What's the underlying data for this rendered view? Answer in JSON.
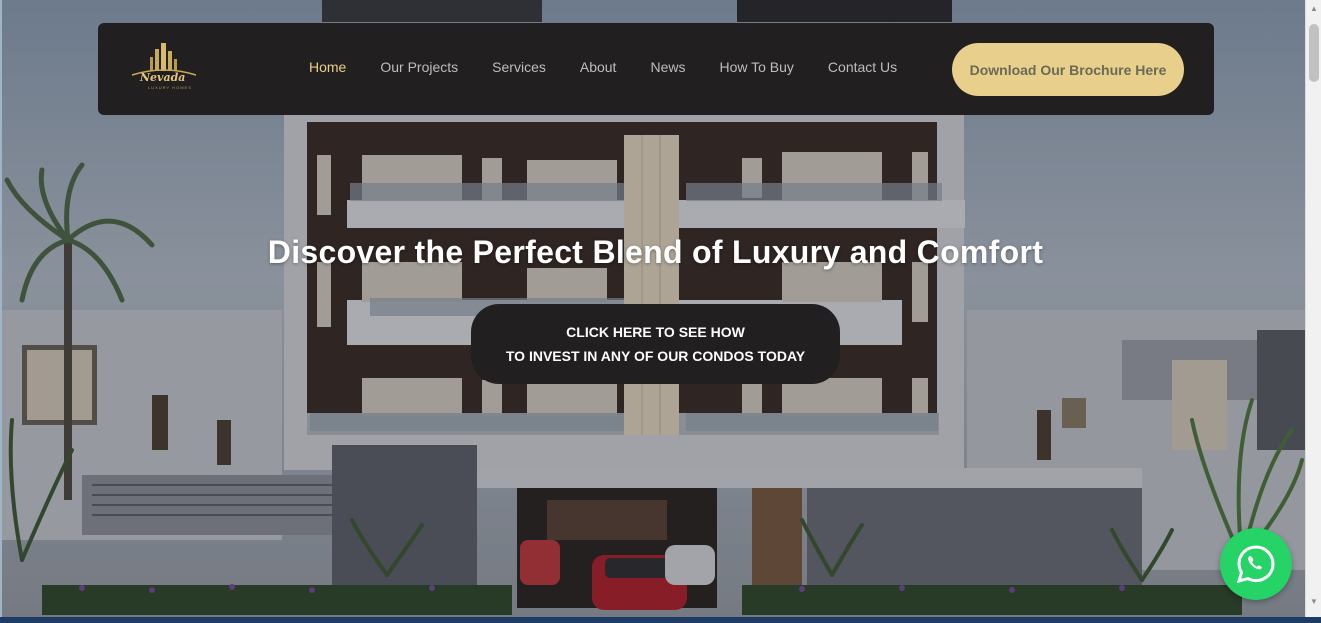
{
  "nav": {
    "logo_text": "Nevada",
    "logo_sub": "LUXURY HOMES",
    "links": [
      "Home",
      "Our Projects",
      "Services",
      "About",
      "News",
      "How To Buy",
      "Contact Us"
    ],
    "brochure_label": "Download Our Brochure Here"
  },
  "hero": {
    "title": "Discover the Perfect Blend of Luxury and Comfort",
    "cta_line1": "CLICK HERE TO SEE HOW",
    "cta_line2": "TO INVEST IN ANY OF OUR CONDOS TODAY"
  },
  "widgets": {
    "whatsapp_icon": "whatsapp-icon"
  },
  "colors": {
    "nav_bg": "#221f20",
    "accent_gold": "#e8cf8c",
    "whatsapp_green": "#25d366"
  }
}
